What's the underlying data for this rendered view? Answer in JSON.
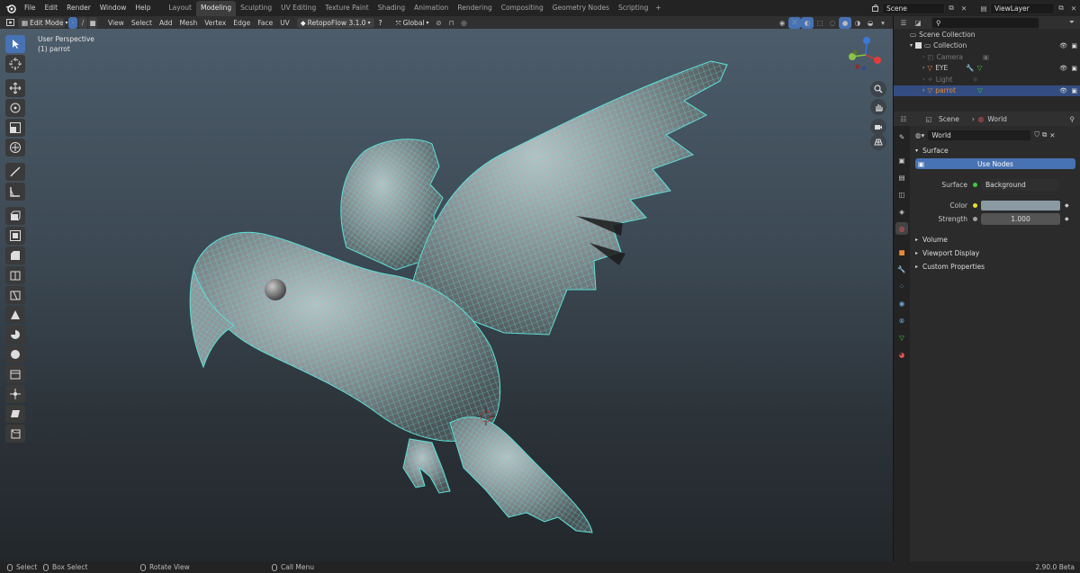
{
  "menubar": {
    "items": [
      "File",
      "Edit",
      "Render",
      "Window",
      "Help"
    ],
    "workspace_tabs": [
      "Layout",
      "Modeling",
      "Sculpting",
      "UV Editing",
      "Texture Paint",
      "Shading",
      "Animation",
      "Rendering",
      "Compositing",
      "Geometry Nodes",
      "Scripting"
    ],
    "active_tab": "Modeling",
    "add_tab": "+",
    "scene_name": "Scene",
    "view_layer": "ViewLayer"
  },
  "viewport_header": {
    "mode": "Edit Mode",
    "menus": [
      "View",
      "Select",
      "Add",
      "Mesh",
      "Vertex",
      "Edge",
      "Face",
      "UV"
    ],
    "addon": "RetopoFlow 3.1.0",
    "orientation": "Global"
  },
  "viewport": {
    "view_name": "User Perspective",
    "object_label": "(1) parrot",
    "accent_color": "#5ee0d8"
  },
  "outliner": {
    "root": "Scene Collection",
    "collection": "Collection",
    "items": [
      {
        "name": "Camera",
        "icon": "camera-icon"
      },
      {
        "name": "EYE",
        "icon": "mesh-icon"
      },
      {
        "name": "Light",
        "icon": "light-icon"
      },
      {
        "name": "parrot",
        "icon": "mesh-icon",
        "selected": true
      }
    ]
  },
  "properties": {
    "breadcrumb_scene": "Scene",
    "breadcrumb_world": "World",
    "world_name": "World",
    "surface_panel": "Surface",
    "use_nodes": "Use Nodes",
    "surface_label": "Surface",
    "surface_value": "Background",
    "color_label": "Color",
    "color_value": "#8a9aa3",
    "strength_label": "Strength",
    "strength_value": "1.000",
    "collapsed_panels": [
      "Volume",
      "Viewport Display",
      "Custom Properties"
    ]
  },
  "statusbar": {
    "select": "Select",
    "box_select": "Box Select",
    "rotate_view": "Rotate View",
    "call_menu": "Call Menu",
    "version": "2.90.0 Beta"
  },
  "colors": {
    "accent_blue": "#4772b3",
    "selection_blue": "#334d80",
    "wire": "#5ee0d8"
  }
}
